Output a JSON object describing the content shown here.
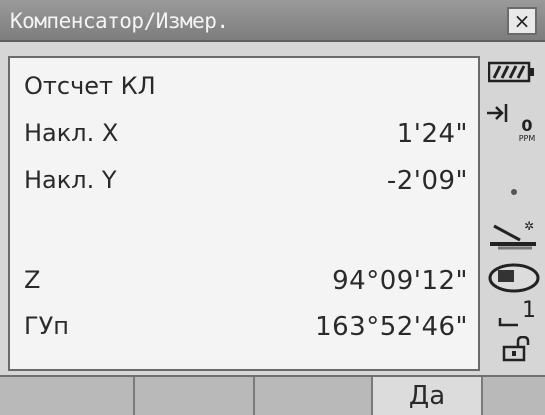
{
  "window": {
    "title": "Компенсатор/Измер.",
    "close_label": "×"
  },
  "readings": {
    "face_label": "Отсчет КЛ",
    "rows": [
      {
        "label": "Накл. X",
        "value": "1'24\""
      },
      {
        "label": "Накл. Y",
        "value": "-2'09\""
      },
      {
        "label": "Z",
        "value": "94°09'12\""
      },
      {
        "label": "ГУп",
        "value": "163°52'46\""
      }
    ]
  },
  "status": {
    "ppm_value": "0",
    "ppm_unit": "PPM",
    "prism_level": "1",
    "icons": [
      "battery-icon",
      "target-arrow-icon",
      "ppm-indicator",
      "dot-icon",
      "tilt-sensor-icon",
      "prism-disk-icon",
      "prism-constant-icon",
      "unlock-icon"
    ]
  },
  "softkeys": [
    "",
    "",
    "",
    "Да",
    ""
  ]
}
